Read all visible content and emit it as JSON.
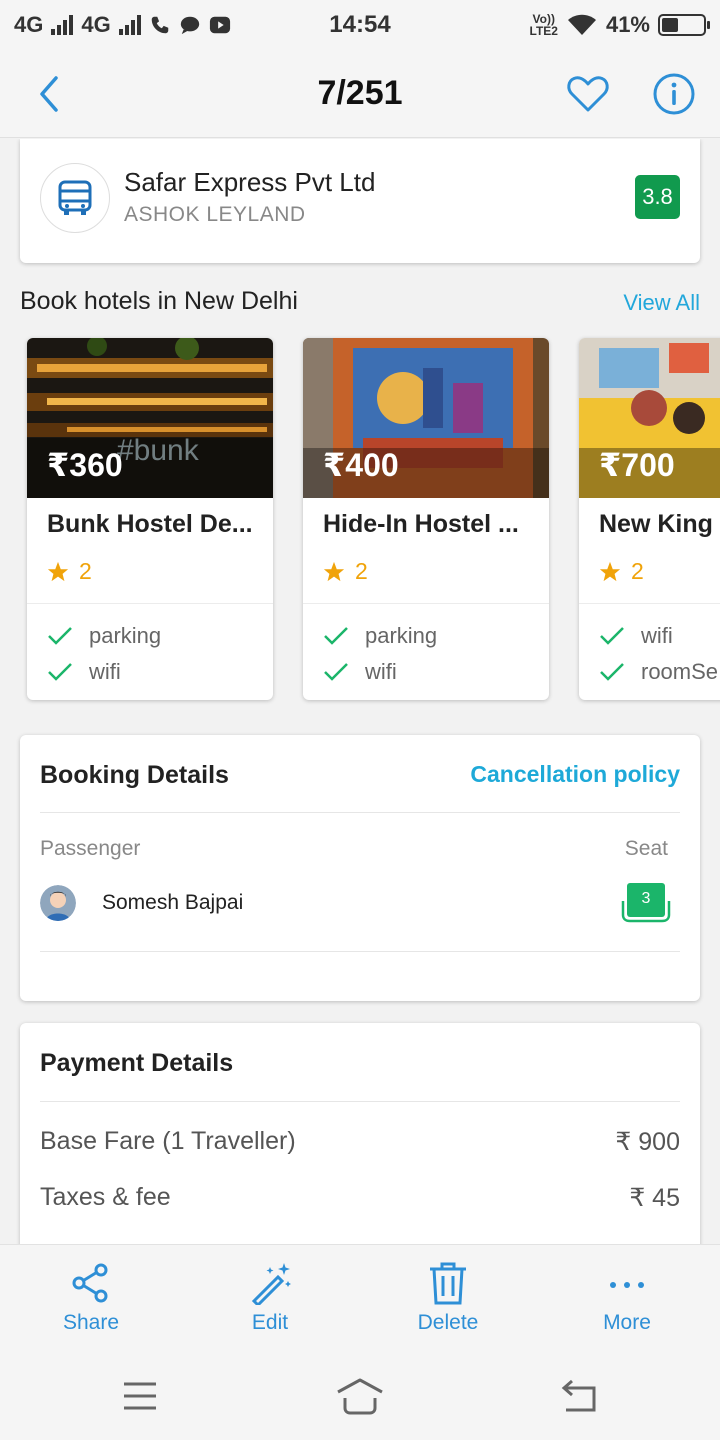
{
  "status_bar": {
    "network1": "4G",
    "network2": "4G",
    "time": "14:54",
    "volte_top": "Vo))",
    "volte_bottom": "LTE2",
    "battery": "41%",
    "battery_level": 0.41
  },
  "app_bar": {
    "title": "7/251",
    "back_icon": "chevron-left-icon",
    "favorite_icon": "heart-icon",
    "info_icon": "info-icon"
  },
  "operator": {
    "name": "Safar Express Pvt Ltd",
    "model": "ASHOK LEYLAND",
    "rating": "3.8",
    "icon": "bus-icon"
  },
  "hotels_section": {
    "title": "Book hotels in New Delhi",
    "view_all": "View All",
    "hotels": [
      {
        "price": "₹360",
        "name": "Bunk Hostel De...",
        "stars": "2",
        "amenities": [
          "parking",
          "wifi"
        ],
        "image_text": "#bunk"
      },
      {
        "price": "₹400",
        "name": "Hide-In Hostel ...",
        "stars": "2",
        "amenities": [
          "parking",
          "wifi"
        ]
      },
      {
        "price": "₹700",
        "name": "New King I",
        "stars": "2",
        "amenities": [
          "wifi",
          "roomSe"
        ]
      }
    ]
  },
  "booking": {
    "title": "Booking Details",
    "cancellation": "Cancellation policy",
    "passenger_header": "Passenger",
    "seat_header": "Seat",
    "passenger_name": "Somesh Bajpai",
    "seat_number": "3"
  },
  "payment": {
    "title": "Payment Details",
    "rows": [
      {
        "label": "Base Fare (1 Traveller)",
        "value": "₹ 900"
      },
      {
        "label": "Taxes & fee",
        "value": "₹ 45"
      }
    ]
  },
  "actions": [
    {
      "label": "Share",
      "icon": "share-icon"
    },
    {
      "label": "Edit",
      "icon": "magic-wand-icon"
    },
    {
      "label": "Delete",
      "icon": "trash-icon"
    },
    {
      "label": "More",
      "icon": "more-dots-icon"
    }
  ],
  "colors": {
    "accent_blue": "#2e8fd6",
    "link_cyan": "#22a7db",
    "rating_green": "#119a4e",
    "star_orange": "#f0a30a",
    "check_green": "#1bb56a"
  }
}
